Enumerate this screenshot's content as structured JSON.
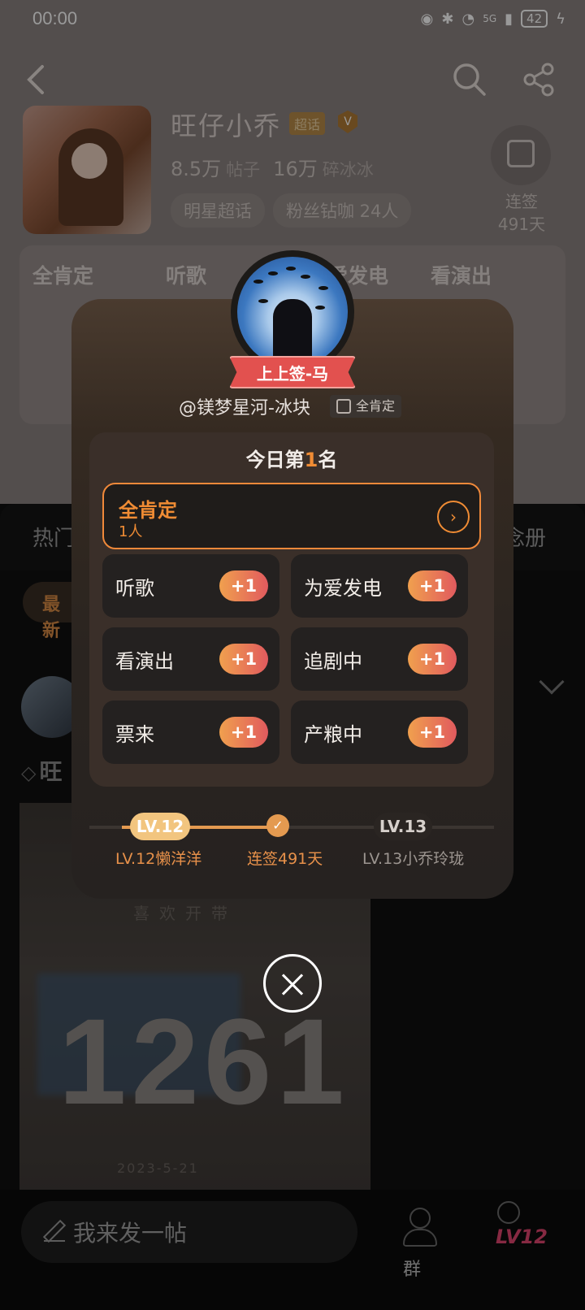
{
  "status_bar": {
    "time": "00:00",
    "network": "5G",
    "battery": "42"
  },
  "topic": {
    "name": "旺仔小乔",
    "super_tag": "超话",
    "v_badge": "V",
    "posts_count": "8.5万",
    "posts_label": "帖子",
    "fans_count": "16万",
    "fans_label": "碎冰冰",
    "chips": [
      "明星超话",
      "粉丝钻咖 24人"
    ],
    "signin_label": "连签",
    "signin_days": "491天"
  },
  "bg_tabs": [
    "全肯定",
    "听歌",
    "为爱发电",
    "看演出"
  ],
  "feed": {
    "tab_left": "热门",
    "tab_right": "念册",
    "new_button": "最新",
    "post_prefix": "旺",
    "post_image_number": "1261",
    "post_image_caption": "喜欢开带",
    "post_image_date": "2023-5-21"
  },
  "bottom": {
    "post_placeholder": "我来发一帖",
    "group_label": "群",
    "level_label": "LV12"
  },
  "modal": {
    "user_title": "上上签-马",
    "username": "@镁梦星河-冰块",
    "user_badge": "全肯定",
    "rank_prefix": "今日第",
    "rank_number": "1",
    "rank_suffix": "名",
    "top_option": {
      "label": "全肯定",
      "count": "1人"
    },
    "options": [
      {
        "label": "听歌",
        "plus": "+1"
      },
      {
        "label": "为爱发电",
        "plus": "+1"
      },
      {
        "label": "看演出",
        "plus": "+1"
      },
      {
        "label": "追剧中",
        "plus": "+1"
      },
      {
        "label": "票来",
        "plus": "+1"
      },
      {
        "label": "产粮中",
        "plus": "+1"
      }
    ],
    "progress": {
      "current_level": "LV.12",
      "current_level_name": "LV.12懒洋洋",
      "streak": "连签491天",
      "next_level": "LV.13",
      "next_level_name": "LV.13小乔玲珑"
    }
  },
  "colors": {
    "accent": "#f08c34",
    "plus_gradient_start": "#f0a04e",
    "plus_gradient_end": "#e15a5e",
    "ribbon": "#e2514f"
  }
}
